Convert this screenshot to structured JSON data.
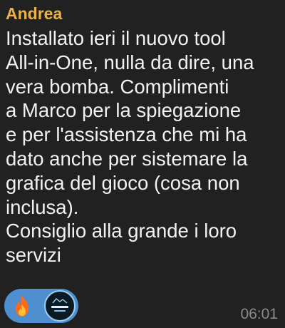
{
  "message": {
    "sender": "Andrea",
    "text": "Installato ieri il nuovo tool\nAll-in-One, nulla da dire, una\nvera bomba. Complimenti\na Marco per la spiegazione\ne per l'assistenza che mi ha\ndato anche per sistemare la\ngrafica del gioco (cosa non\ninclusa).\nConsiglio alla grande i loro\nservizi",
    "time": "06:01"
  },
  "reaction": {
    "emoji_icon": "fire-icon",
    "avatar_icon": "user-avatar",
    "accent_color": "#4f8fcf"
  },
  "colors": {
    "sender_name": "#e8b24a",
    "background": "#212121",
    "text": "#f2f2f2",
    "timestamp": "#8a8a8a"
  }
}
